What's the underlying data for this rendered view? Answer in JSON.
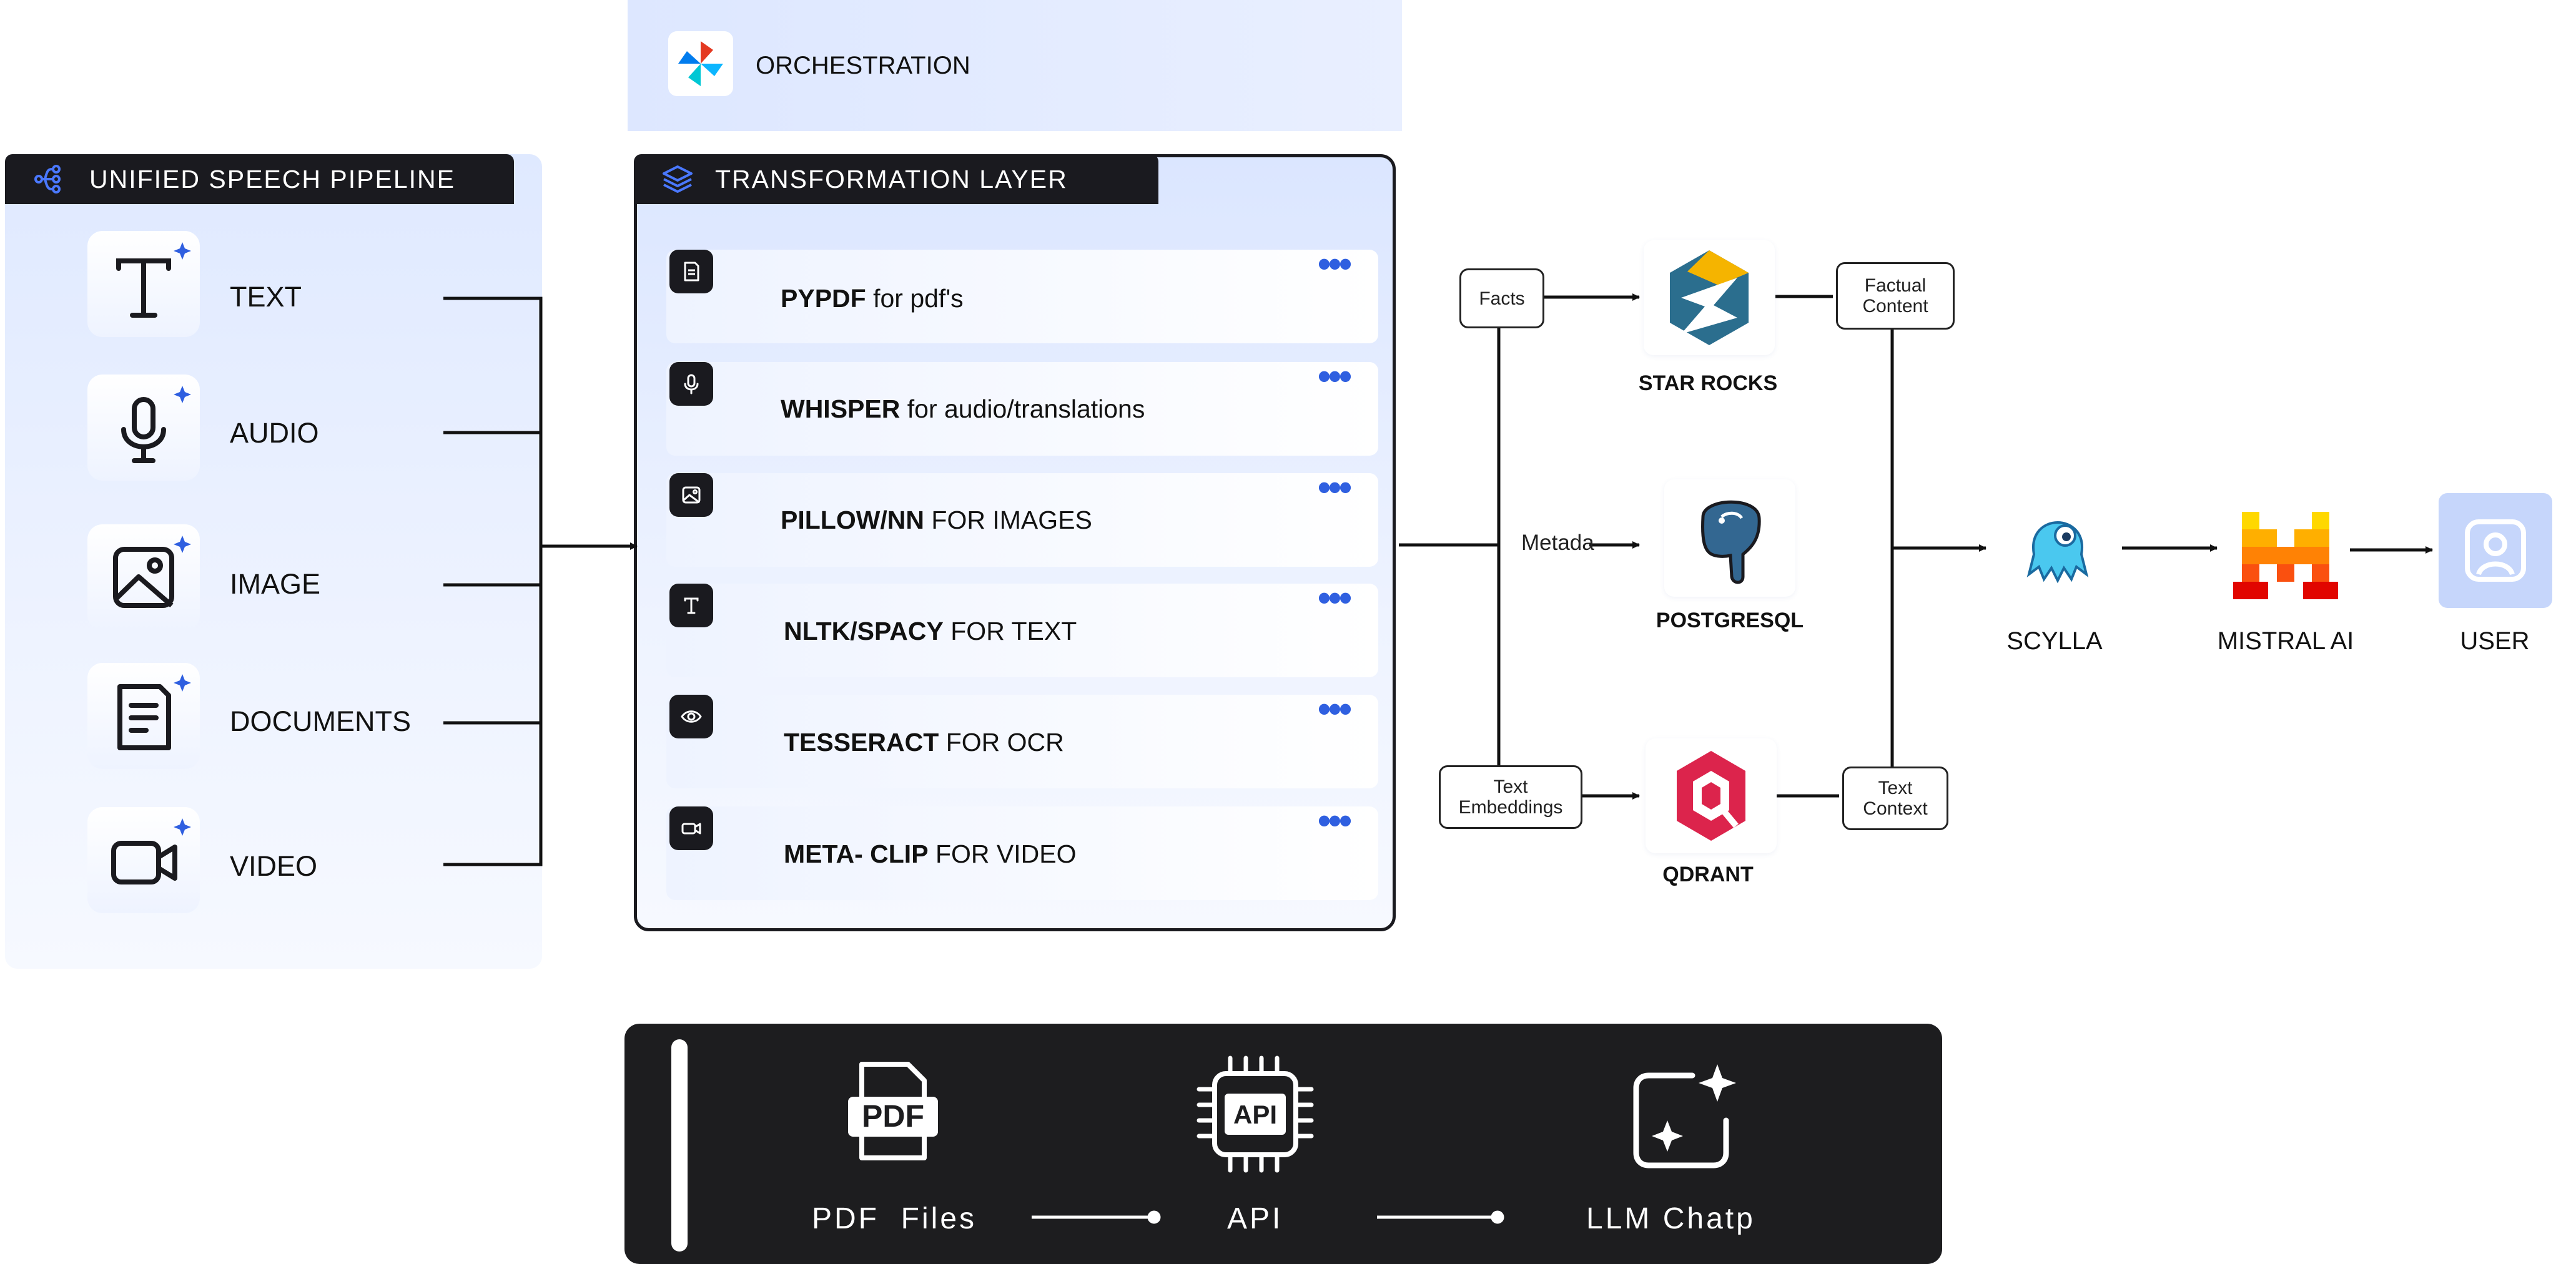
{
  "orchestration": {
    "title": "ORCHESTRATION"
  },
  "pipeline": {
    "title": "UNIFIED SPEECH PIPELINE",
    "items": [
      {
        "label": "TEXT",
        "icon": "text-icon"
      },
      {
        "label": "AUDIO",
        "icon": "microphone-icon"
      },
      {
        "label": "IMAGE",
        "icon": "image-icon"
      },
      {
        "label": "DOCUMENTS",
        "icon": "document-icon"
      },
      {
        "label": "VIDEO",
        "icon": "video-icon"
      }
    ]
  },
  "transformation": {
    "title": "TRANSFORMATION LAYER",
    "rows": [
      {
        "tool": "PYPDF",
        "desc": " for pdf's",
        "icon": "document-icon"
      },
      {
        "tool": "WHISPER",
        "desc": " for audio/translations",
        "icon": "microphone-icon"
      },
      {
        "tool": "PILLOW/NN",
        "desc": " FOR IMAGES",
        "icon": "image-icon"
      },
      {
        "tool": "NLTK/SPACY",
        "desc": " FOR TEXT",
        "icon": "text-icon"
      },
      {
        "tool": "TESSERACT",
        "desc": " FOR OCR",
        "icon": "eye-icon"
      },
      {
        "tool": "META- CLIP",
        "desc": " FOR VIDEO",
        "icon": "video-icon"
      }
    ]
  },
  "storage": {
    "facts": "Facts",
    "metadata": "Metada",
    "text_embeddings_1": "Text",
    "text_embeddings_2": "Embeddings",
    "factual_content_1": "Factual",
    "factual_content_2": "Content",
    "text_context_1": "Text",
    "text_context_2": "Context",
    "starrocks": "STAR ROCKS",
    "postgresql": "POSTGRESQL",
    "qdrant": "QDRANT"
  },
  "serving": {
    "scylla": "SCYLLA",
    "mistral": "MISTRAL AI",
    "user": "USER"
  },
  "bottom": {
    "pdf_label": "PDF  Files",
    "pdf_icon_text": "PDF",
    "api_label": "API",
    "api_icon_text": "API",
    "llm_label": "LLM Chatp"
  },
  "colors": {
    "accent_blue": "#2f5fe0",
    "panel_bg": "#e4ecff",
    "dark": "#1a1a1f"
  }
}
